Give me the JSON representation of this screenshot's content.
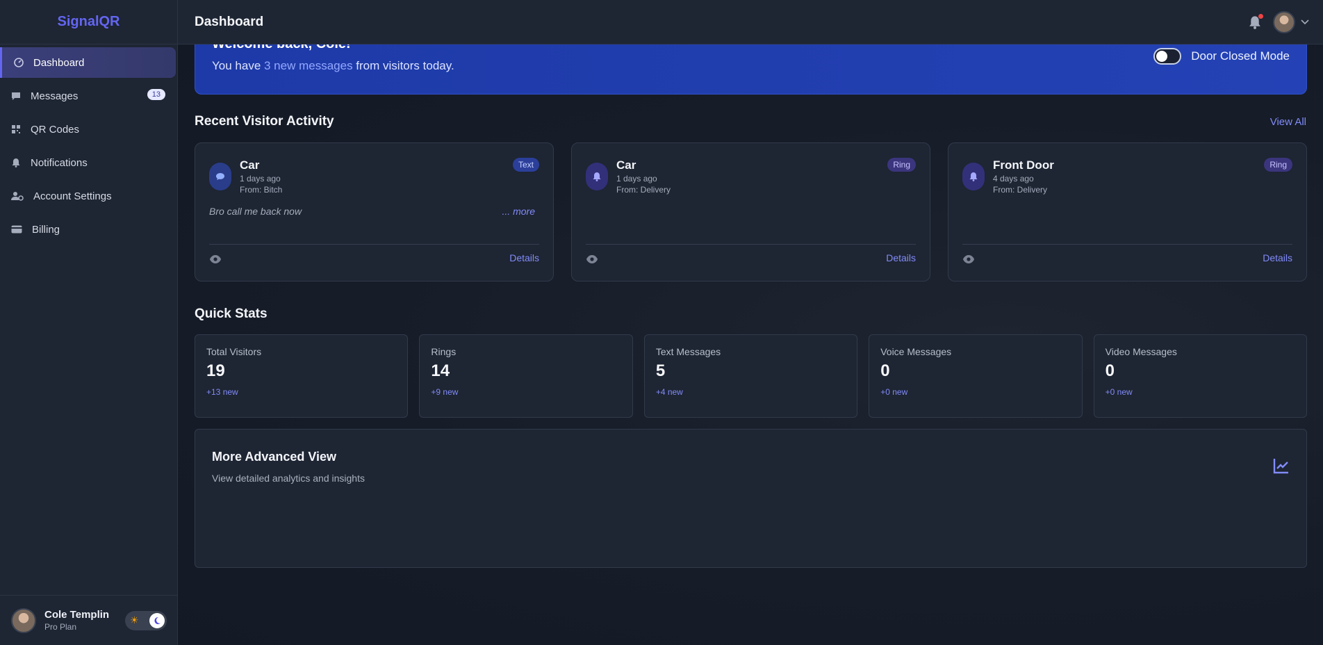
{
  "app": {
    "logo": "SignalQR"
  },
  "sidebar": {
    "items": [
      {
        "label": "Dashboard",
        "icon": "dashboard-icon",
        "active": true
      },
      {
        "label": "Messages",
        "icon": "message-icon",
        "badge": "13"
      },
      {
        "label": "QR Codes",
        "icon": "qr-icon"
      },
      {
        "label": "Notifications",
        "icon": "bell-icon"
      },
      {
        "label": "Account Settings",
        "icon": "user-gear-icon"
      },
      {
        "label": "Billing",
        "icon": "credit-card-icon"
      }
    ],
    "user": {
      "name": "Cole Templin",
      "plan": "Pro Plan"
    }
  },
  "header": {
    "title": "Dashboard"
  },
  "welcome": {
    "title": "Welcome back, Cole!",
    "text_before": "You have ",
    "highlight": "3 new messages",
    "text_after": " from visitors today.",
    "toggle_label": "Door Closed Mode",
    "toggle_on": false
  },
  "recent": {
    "title": "Recent Visitor Activity",
    "view_all": "View All",
    "cards": [
      {
        "location": "Car",
        "time": "1 days ago",
        "from": "From: Bitch",
        "tag": "Text",
        "message": "Bro call me back now",
        "more": "... more",
        "details": "Details"
      },
      {
        "location": "Car",
        "time": "1 days ago",
        "from": "From: Delivery",
        "tag": "Ring",
        "details": "Details"
      },
      {
        "location": "Front Door",
        "time": "4 days ago",
        "from": "From: Delivery",
        "tag": "Ring",
        "details": "Details"
      }
    ]
  },
  "stats": {
    "title": "Quick Stats",
    "items": [
      {
        "label": "Total Visitors",
        "value": "19",
        "delta": "+13 new"
      },
      {
        "label": "Rings",
        "value": "14",
        "delta": "+9 new"
      },
      {
        "label": "Text Messages",
        "value": "5",
        "delta": "+4 new"
      },
      {
        "label": "Voice Messages",
        "value": "0",
        "delta": "+0 new"
      },
      {
        "label": "Video Messages",
        "value": "0",
        "delta": "+0 new"
      }
    ]
  },
  "advanced": {
    "title": "More Advanced View",
    "subtitle": "View detailed analytics and insights"
  },
  "colors": {
    "accent": "#6366f1",
    "link": "#818cf8",
    "banner": "#1e3aa8",
    "notification_dot": "#ef4444"
  }
}
